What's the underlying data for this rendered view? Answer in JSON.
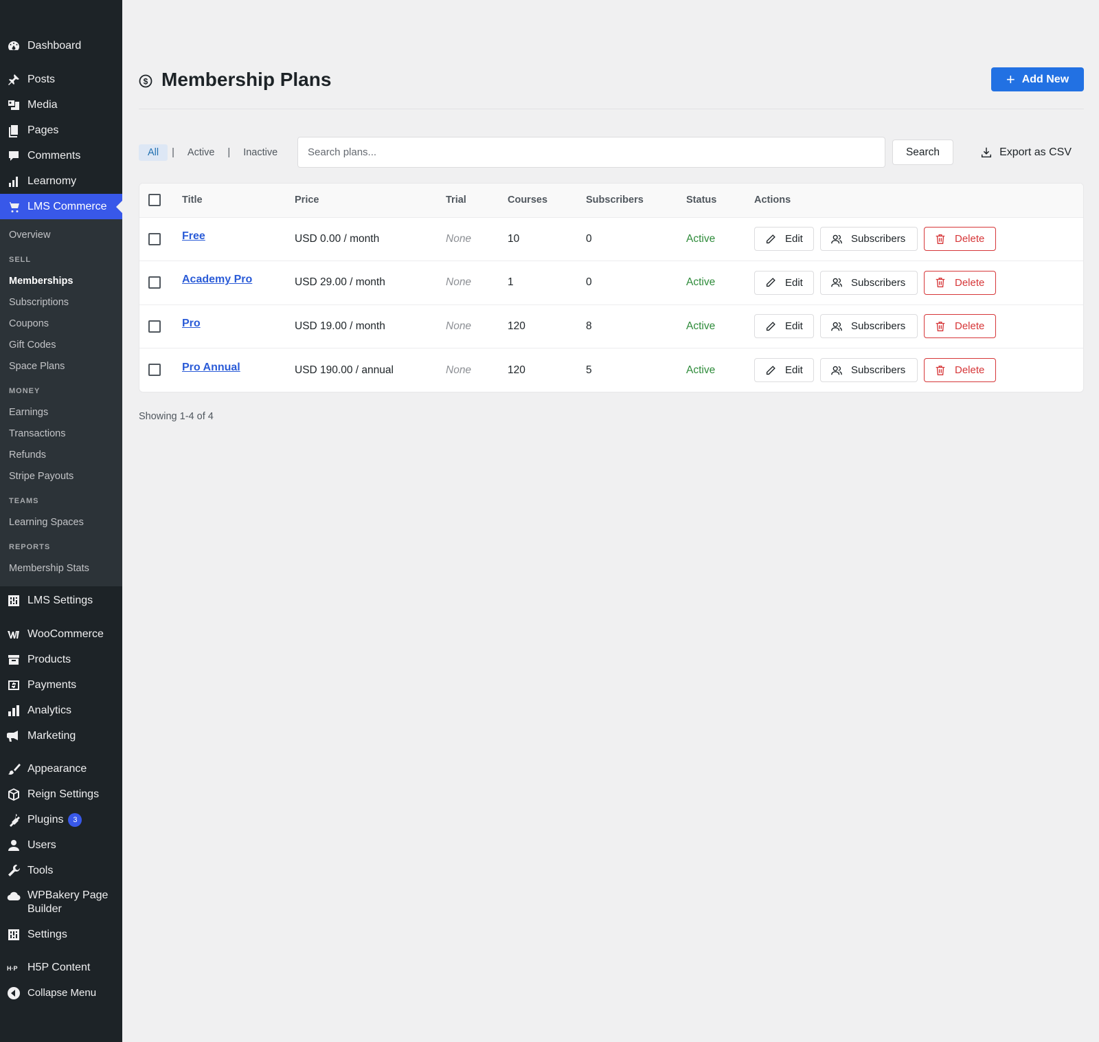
{
  "sidebar": {
    "top_items": [
      {
        "label": "Dashboard",
        "icon": "dashboard-icon"
      },
      {
        "label": "Posts",
        "icon": "pin-icon"
      },
      {
        "label": "Media",
        "icon": "media-icon"
      },
      {
        "label": "Pages",
        "icon": "pages-icon"
      },
      {
        "label": "Comments",
        "icon": "comments-icon"
      },
      {
        "label": "Learnomy",
        "icon": "chart-icon"
      },
      {
        "label": "LMS Commerce",
        "icon": "cart-icon"
      }
    ],
    "submenu": {
      "overview": "Overview",
      "sell_heading": "SELL",
      "sell": [
        "Memberships",
        "Subscriptions",
        "Coupons",
        "Gift Codes",
        "Space Plans"
      ],
      "money_heading": "MONEY",
      "money": [
        "Earnings",
        "Transactions",
        "Refunds",
        "Stripe Payouts"
      ],
      "teams_heading": "TEAMS",
      "teams": [
        "Learning Spaces"
      ],
      "reports_heading": "REPORTS",
      "reports": [
        "Membership Stats"
      ]
    },
    "bottom_items": [
      {
        "label": "LMS Settings",
        "icon": "settings-icon"
      },
      {
        "label": "WooCommerce",
        "icon": "woo-icon"
      },
      {
        "label": "Products",
        "icon": "archive-icon"
      },
      {
        "label": "Payments",
        "icon": "dollar-icon"
      },
      {
        "label": "Analytics",
        "icon": "bar-chart-icon"
      },
      {
        "label": "Marketing",
        "icon": "megaphone-icon"
      },
      {
        "label": "Appearance",
        "icon": "brush-icon"
      },
      {
        "label": "Reign Settings",
        "icon": "cube-icon"
      },
      {
        "label": "Plugins",
        "icon": "plugin-icon",
        "badge": "3"
      },
      {
        "label": "Users",
        "icon": "user-icon"
      },
      {
        "label": "Tools",
        "icon": "wrench-icon"
      },
      {
        "label": "WPBakery Page Builder",
        "icon": "cloud-icon"
      },
      {
        "label": "Settings",
        "icon": "settings-icon"
      },
      {
        "label": "H5P Content",
        "icon": "h5p-icon"
      },
      {
        "label": "Collapse Menu",
        "icon": "collapse-icon"
      }
    ]
  },
  "header": {
    "title": "Membership Plans",
    "add_new": "Add New"
  },
  "filters": {
    "all": "All",
    "active": "Active",
    "inactive": "Inactive",
    "separator": "|"
  },
  "search": {
    "placeholder": "Search plans...",
    "button": "Search"
  },
  "export_label": "Export as CSV",
  "table": {
    "columns": [
      "Title",
      "Price",
      "Trial",
      "Courses",
      "Subscribers",
      "Status",
      "Actions"
    ],
    "rows": [
      {
        "title": "Free",
        "price": "USD 0.00 / month",
        "trial": "None",
        "courses": "10",
        "subscribers": "0",
        "status": "Active"
      },
      {
        "title": "Academy Pro",
        "price": "USD 29.00 / month",
        "trial": "None",
        "courses": "1",
        "subscribers": "0",
        "status": "Active"
      },
      {
        "title": "Pro",
        "price": "USD 19.00 / month",
        "trial": "None",
        "courses": "120",
        "subscribers": "8",
        "status": "Active"
      },
      {
        "title": "Pro Annual",
        "price": "USD 190.00 / annual",
        "trial": "None",
        "courses": "120",
        "subscribers": "5",
        "status": "Active"
      }
    ],
    "actions": {
      "edit": "Edit",
      "subscribers": "Subscribers",
      "delete": "Delete"
    }
  },
  "footer": {
    "showing": "Showing 1-4 of 4"
  },
  "colors": {
    "accent": "#3858e9",
    "primary_button": "#2271e3",
    "status_active": "#2e8b3a",
    "danger": "#d63638",
    "sidebar_bg": "#1d2327"
  }
}
